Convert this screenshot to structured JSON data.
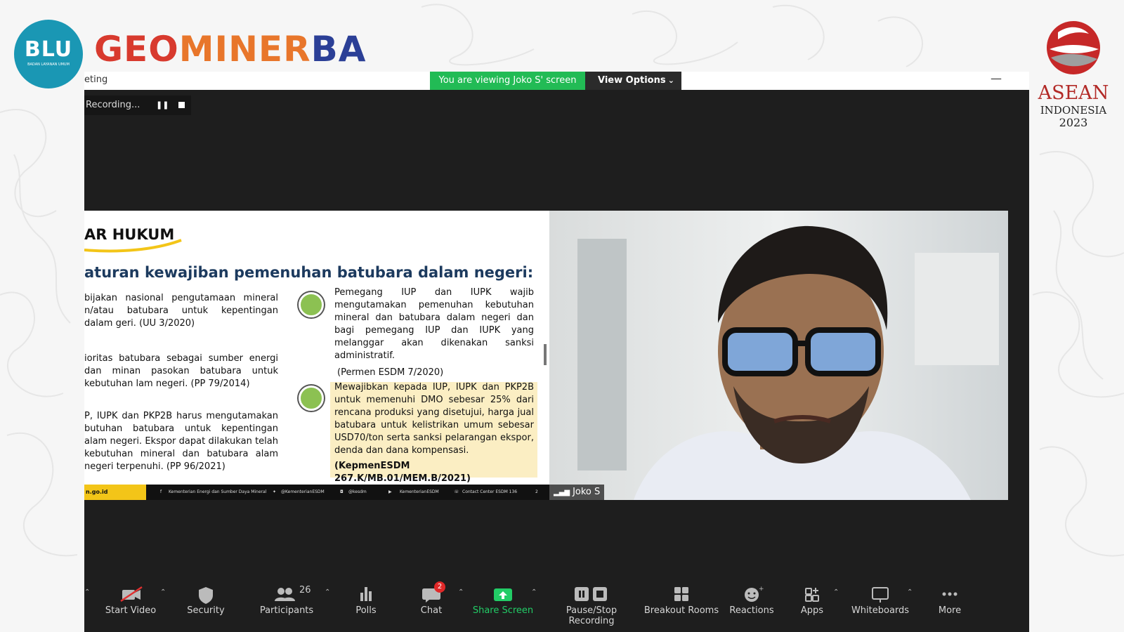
{
  "branding": {
    "blu_text": "BLU",
    "blu_subtext": "BADAN LAYANAN UMUM",
    "geo_part1": "GEO",
    "geo_part2": "MINER",
    "geo_part3": "BA",
    "asean_line1": "ASEAN",
    "asean_line2": "INDONESIA",
    "asean_line3": "2023"
  },
  "window": {
    "title_fragment": "eting",
    "viewing_banner": "You are viewing Joko S' screen",
    "view_options_label": "View Options",
    "minimize_label": "—"
  },
  "recording": {
    "status": "Recording...",
    "pause_symbol": "❚❚"
  },
  "slide": {
    "title": "AR HUKUM",
    "heading": "aturan kewajiban pemenuhan batubara dalam negeri:",
    "left_items": [
      "bijakan nasional pengutamaan mineral n/atau batubara untuk kepentingan dalam geri. (UU 3/2020)",
      "ioritas batubara sebagai sumber energi dan minan pasokan batubara untuk kebutuhan lam negeri. (PP 79/2014)",
      "P, IUPK dan PKP2B harus mengutamakan butuhan batubara untuk kepentingan alam negeri. Ekspor dapat dilakukan telah kebutuhan mineral dan batubara alam negeri terpenuhi. (PP 96/2021)"
    ],
    "right_items": [
      {
        "text": "Pemegang IUP dan IUPK wajib mengutamakan pemenuhan kebutuhan mineral dan batubara dalam negeri dan bagi pemegang IUP dan IUPK yang melanggar akan dikenakan sanksi administratif.",
        "ref": "(Permen ESDM 7/2020)"
      },
      {
        "text": "Mewajibkan kepada IUP, IUPK dan PKP2B untuk memenuhi DMO sebesar 25% dari rencana produksi yang disetujui, harga jual batubara untuk kelistrikan umum sebesar USD70/ton serta sanksi pelarangan ekspor, denda dan dana kompensasi.",
        "ref": "(KepmenESDM 267.K/MB.01/MEM.B/2021)"
      }
    ],
    "footer": {
      "website": "n.go.id",
      "facebook": "Kementerian Energi dan Sumber Daya Mineral",
      "twitter": "@KementerianESDM",
      "instagram": "@kesdm",
      "youtube": "KementerianESDM",
      "contact": "Contact Center ESDM 136",
      "page": "2"
    }
  },
  "participant": {
    "name": "Joko S"
  },
  "toolbar": {
    "items": [
      {
        "label": "Start Video",
        "icon": "video-off-icon"
      },
      {
        "label": "Security",
        "icon": "shield-icon"
      },
      {
        "label": "Participants",
        "icon": "participants-icon",
        "count": "26"
      },
      {
        "label": "Polls",
        "icon": "polls-icon"
      },
      {
        "label": "Chat",
        "icon": "chat-icon",
        "badge": "2"
      },
      {
        "label": "Share Screen",
        "icon": "share-screen-icon"
      },
      {
        "label": "Pause/Stop Recording",
        "icon": "pause-stop-icon"
      },
      {
        "label": "Breakout Rooms",
        "icon": "breakout-rooms-icon"
      },
      {
        "label": "Reactions",
        "icon": "reactions-icon"
      },
      {
        "label": "Apps",
        "icon": "apps-icon"
      },
      {
        "label": "Whiteboards",
        "icon": "whiteboard-icon"
      },
      {
        "label": "More",
        "icon": "more-icon"
      }
    ]
  },
  "colors": {
    "zoom_bg": "#1e1e1e",
    "banner_green": "#22bb55",
    "share_green": "#22cc66",
    "slide_heading": "#1c3a5e",
    "highlight": "#fbeec3",
    "bullet_green": "#8cc152",
    "footer_yellow": "#f3c518"
  }
}
